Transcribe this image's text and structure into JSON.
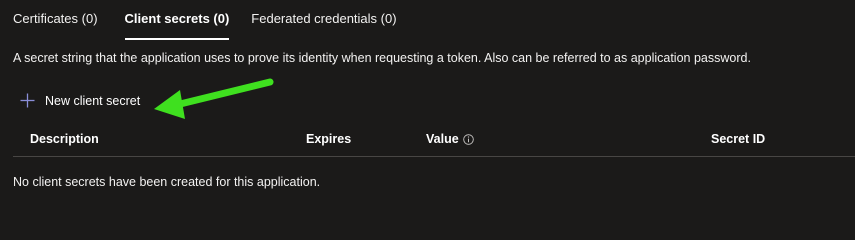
{
  "tabs": [
    {
      "label": "Certificates (0)",
      "active": false
    },
    {
      "label": "Client secrets (0)",
      "active": true
    },
    {
      "label": "Federated credentials (0)",
      "active": false
    }
  ],
  "description": "A secret string that the application uses to prove its identity when requesting a token. Also can be referred to as application password.",
  "toolbar": {
    "new_secret_label": "New client secret",
    "new_secret_icon": "plus-icon"
  },
  "table": {
    "columns": [
      "Description",
      "Expires",
      "Value",
      "Secret ID"
    ],
    "value_info_icon": "info-icon",
    "empty_message": "No client secrets have been created for this application."
  },
  "annotation": {
    "arrow_color": "#3fe01f",
    "arrow_icon": "arrow-annotation-icon"
  },
  "colors": {
    "background": "#1b1a19",
    "accent_plus": "#8a8ed8",
    "divider": "#484644"
  }
}
